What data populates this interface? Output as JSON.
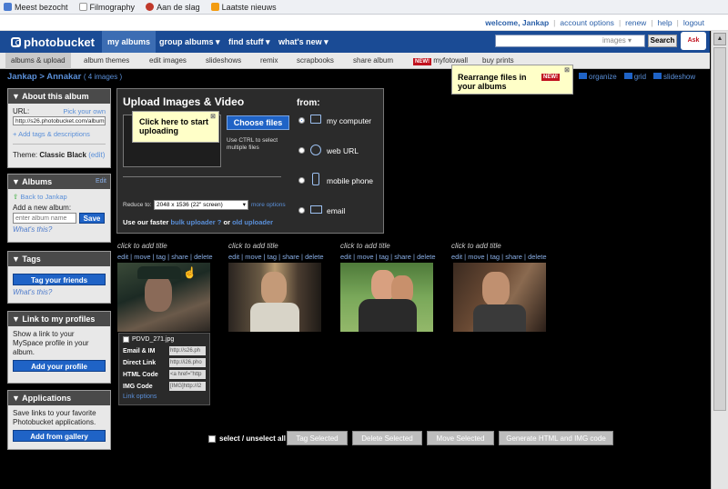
{
  "bookmarks": [
    "Meest bezocht",
    "Filmography",
    "Aan de slag",
    "Laatste nieuws"
  ],
  "userbar": {
    "welcome": "welcome, Jankap",
    "links": [
      "account options",
      "renew",
      "help",
      "logout"
    ]
  },
  "logo": "photobucket",
  "nav": [
    "my albums",
    "group albums ▾",
    "find stuff ▾",
    "what's new ▾"
  ],
  "search": {
    "scope": "images ▾",
    "button": "Search",
    "badge": "Ask"
  },
  "subnav": [
    "albums & upload",
    "album themes",
    "edit images",
    "slideshows",
    "remix",
    "scrapbooks",
    "share album",
    "myfotowall",
    "buy prints"
  ],
  "subnav_new": "NEW!",
  "crumb": {
    "user": "Jankap",
    "sep": ">",
    "album": "Annakar",
    "count": "( 4 images )"
  },
  "about": {
    "title": "About this album",
    "url_label": "URL:",
    "pick": "Pick your own",
    "url_value": "http://s26.photobucket.com/albums",
    "tags_link": "Add tags & descriptions",
    "theme_label": "Theme:",
    "theme": "Classic Black",
    "edit": "(edit)"
  },
  "albums": {
    "title": "Albums",
    "edit": "Edit",
    "back": "Back to Jankap",
    "add_label": "Add a new album:",
    "placeholder": "enter album name",
    "save": "Save",
    "whats": "What's this?"
  },
  "tags": {
    "title": "Tags",
    "button": "Tag your friends",
    "whats": "What's this?"
  },
  "link_profiles": {
    "title": "Link to my profiles",
    "text": "Show a link to your MySpace profile in your album.",
    "button": "Add your profile"
  },
  "applications": {
    "title": "Applications",
    "text": "Save links to your favorite Photobucket applications.",
    "button": "Add from gallery"
  },
  "upload": {
    "title": "Upload Images & Video",
    "choose": "Choose files",
    "hint": "Use CTRL to select multiple files",
    "reduce_label": "Reduce to:",
    "reduce_value": "2048 x 1536 (22\" screen)",
    "more": "more options",
    "faster": "Use our faster",
    "bulk": "bulk uploader",
    "q": "?",
    "or": "or",
    "old": "old uploader",
    "from": "from:",
    "sources": [
      "my computer",
      "web URL",
      "mobile phone",
      "email"
    ]
  },
  "tip_upload": "Click here to start uploading",
  "tip_rearrange": {
    "text": "Rearrange files in your albums",
    "badge": "NEW!"
  },
  "views": [
    "organize",
    "grid",
    "slideshow"
  ],
  "thumbs": [
    {
      "caption": "click to add title",
      "actions": "edit | move | tag | share | delete"
    },
    {
      "caption": "click to add title",
      "actions": "edit | move | tag | share | delete"
    },
    {
      "caption": "click to add title",
      "actions": "edit | move | tag | share | delete"
    },
    {
      "caption": "click to add title",
      "actions": "edit | move | tag | share | delete"
    }
  ],
  "detail": {
    "filename": "PDVD_271.jpg",
    "rows": [
      [
        "Email & IM",
        "http://s26.ph"
      ],
      [
        "Direct Link",
        "http://i26.pho"
      ],
      [
        "HTML Code",
        "<a href=\"http"
      ],
      [
        "IMG Code",
        "[IMG]http://i2"
      ]
    ],
    "link_options": "Link options"
  },
  "bottom": {
    "select": "select / unselect all",
    "buttons": [
      "Tag Selected",
      "Delete Selected",
      "Move Selected",
      "Generate HTML and IMG code"
    ]
  }
}
